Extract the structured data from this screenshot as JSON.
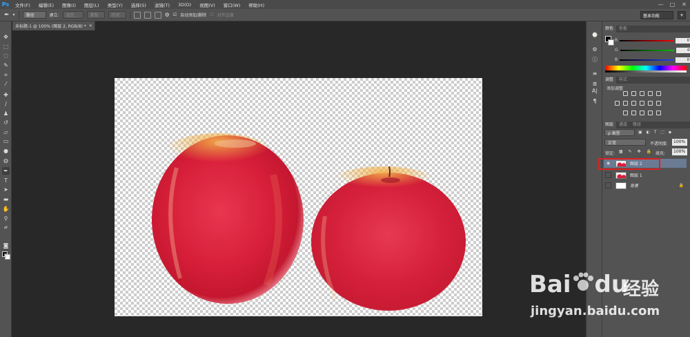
{
  "app": {
    "logo": "Ps",
    "menu": [
      "文件(F)",
      "编辑(E)",
      "图像(I)",
      "图层(L)",
      "类型(Y)",
      "选择(S)",
      "滤镜(T)",
      "3D(D)",
      "视图(V)",
      "窗口(W)",
      "帮助(H)"
    ],
    "window_controls": [
      "—",
      "□",
      "✕"
    ]
  },
  "options": {
    "mode": "路径",
    "make_label": "建立:",
    "selection_btn": "选区...",
    "mask_btn": "蒙版",
    "shape_btn": "形状",
    "auto_add_delete": "自动添加/删除",
    "align_edges": "对齐边缘",
    "workspace": "基本功能"
  },
  "document": {
    "tab_title": "未标题-1 @ 100% (图层 2, RGB/8) *"
  },
  "color_panel": {
    "tabs": [
      "颜色",
      "色板"
    ],
    "channels": [
      {
        "label": "R",
        "value": "0",
        "color": "#e03030"
      },
      {
        "label": "G",
        "value": "0",
        "color": "#30b030"
      },
      {
        "label": "B",
        "value": "0",
        "color": "#3050e0"
      }
    ]
  },
  "adjust_panel": {
    "tabs": [
      "调整",
      "样式"
    ],
    "title": "添加调整"
  },
  "layers_panel": {
    "tabs": [
      "图层",
      "通道",
      "路径"
    ],
    "filter_kind": "ρ 类型",
    "blend_mode": "正常",
    "opacity_label": "不透明度:",
    "opacity_value": "100%",
    "lock_label": "锁定:",
    "fill_label": "填充:",
    "fill_value": "100%",
    "layers": [
      {
        "name": "图层 2",
        "selected": true,
        "visible": true,
        "thumb": "apples"
      },
      {
        "name": "图层 1",
        "selected": false,
        "visible": false,
        "thumb": "apples"
      },
      {
        "name": "背景",
        "selected": false,
        "visible": false,
        "thumb": "white",
        "locked": true
      }
    ]
  },
  "watermark": {
    "brand": "Bai",
    "brand_end": "du",
    "cn": "经验",
    "url": "jingyan.baidu.com"
  }
}
